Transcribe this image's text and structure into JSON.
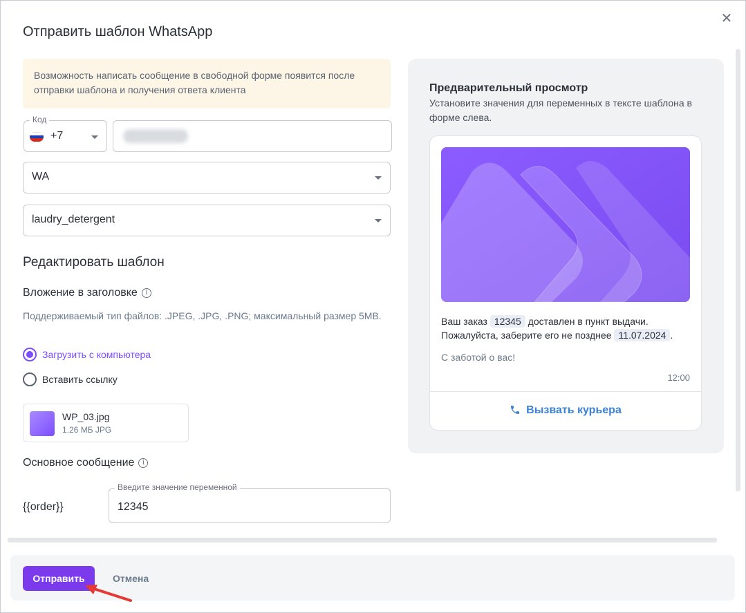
{
  "dialog": {
    "title": "Отправить шаблон WhatsApp",
    "close_icon": "close-icon"
  },
  "notice": {
    "text": "Возможность написать сообщение в свободной форме появится после отправки шаблона и получения ответа клиента"
  },
  "phone": {
    "code_legend": "Код",
    "country_flag": "russia-flag-icon",
    "code_value": "+7"
  },
  "channel_select": {
    "value": "WA"
  },
  "template_select": {
    "value": "laudry_detergent"
  },
  "editor": {
    "heading": "Редактировать шаблон",
    "attachment_heading": "Вложение в заголовке",
    "attachment_hint": "Поддерживаемый тип файлов: .JPEG, .JPG, .PNG; максимальный размер 5MB.",
    "options": [
      {
        "label": "Загрузить с компьютера",
        "selected": true
      },
      {
        "label": "Вставить ссылку",
        "selected": false
      }
    ],
    "file": {
      "name": "WP_03.jpg",
      "meta": "1.26 МБ JPG"
    },
    "body_heading": "Основное сообщение",
    "variable": {
      "name": "{{order}}",
      "legend": "Введите значение переменной",
      "value": "12345"
    }
  },
  "preview": {
    "title": "Предварительный просмотр",
    "subtitle": "Установите значения для переменных в тексте шаблона в форме слева.",
    "message": {
      "part1": "Ваш заказ ",
      "order": "12345",
      "part2": " доставлен в пункт выдачи.",
      "part3": "Пожалуйста, заберите его не позднее ",
      "date": "11.07.2024",
      "part4": "."
    },
    "signature": "С заботой о вас!",
    "time": "12:00",
    "call_button": "Вызвать курьера",
    "accent_color": "#3b82d6"
  },
  "footer": {
    "send_label": "Отправить",
    "cancel_label": "Отмена",
    "send_color": "#7c3aed"
  }
}
